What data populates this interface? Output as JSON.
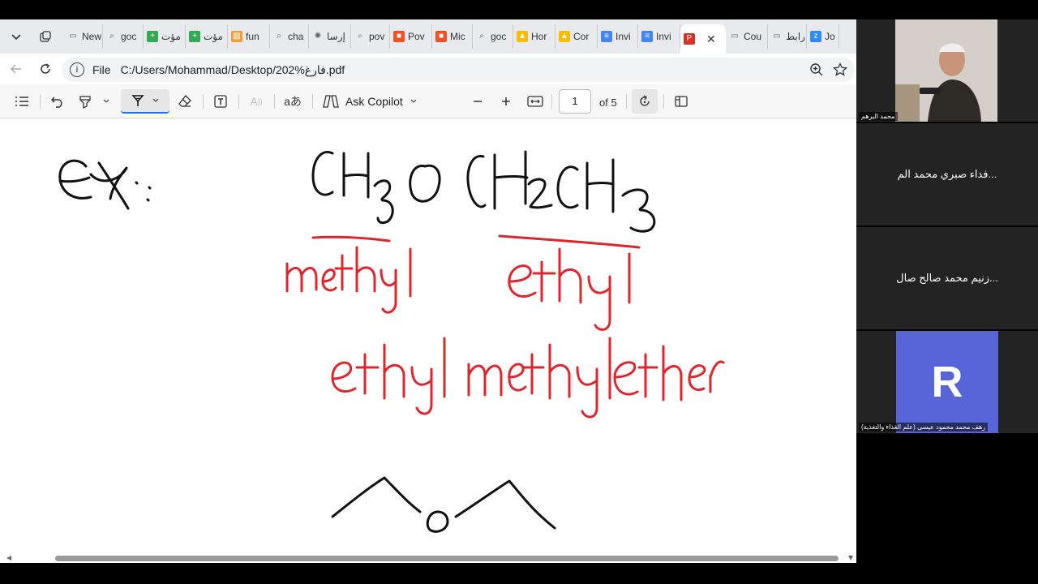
{
  "browser": {
    "tabs": [
      {
        "label": "New",
        "icon": "page-icon",
        "color": "#5f6368"
      },
      {
        "label": "goc",
        "icon": "search-icon",
        "color": "#5f6368"
      },
      {
        "label": "مؤت",
        "icon": "plus-doc-icon",
        "color": "#34a853"
      },
      {
        "label": "مؤت",
        "icon": "plus-doc-icon",
        "color": "#34a853"
      },
      {
        "label": "fun",
        "icon": "image-icon",
        "color": "#e9a23b"
      },
      {
        "label": "cha",
        "icon": "search-icon",
        "color": "#5f6368"
      },
      {
        "label": "إرسا",
        "icon": "openai-icon",
        "color": "#5f6368"
      },
      {
        "label": "pov",
        "icon": "search-icon",
        "color": "#5f6368"
      },
      {
        "label": "Pov",
        "icon": "microsoft-icon",
        "color": "#f25022"
      },
      {
        "label": "Mic",
        "icon": "microsoft-icon",
        "color": "#f25022"
      },
      {
        "label": "goc",
        "icon": "search-icon",
        "color": "#5f6368"
      },
      {
        "label": "Hor",
        "icon": "drive-icon",
        "color": "#fbbc04"
      },
      {
        "label": "Cor",
        "icon": "drive-icon",
        "color": "#fbbc04"
      },
      {
        "label": "Invi",
        "icon": "docs-icon",
        "color": "#4285f4"
      },
      {
        "label": "Invi",
        "icon": "docs-icon",
        "color": "#4285f4"
      },
      {
        "label": "",
        "icon": "pdf-icon",
        "color": "#d93025",
        "active": true
      },
      {
        "label": "Cou",
        "icon": "page-icon",
        "color": "#5f6368"
      },
      {
        "label": "رابط",
        "icon": "page-icon",
        "color": "#5f6368"
      },
      {
        "label": "Jo",
        "icon": "zoom-icon",
        "color": "#2d8cff"
      }
    ],
    "address": {
      "prefix": "File",
      "url": "C:/Users/Mohammad/Desktop/202%فارغ.pdf"
    }
  },
  "pdf_toolbar": {
    "ask_copilot": "Ask Copilot",
    "page_current": "1",
    "page_total": "of 5"
  },
  "annotations": {
    "ink_black": "#111111",
    "ink_red": "#e0262d"
  },
  "participants": [
    {
      "type": "video",
      "caption": "محمد البرهم"
    },
    {
      "type": "name",
      "name": "...فداء صبري محمد الم"
    },
    {
      "type": "name",
      "name": "...زنيم محمد صالح صال"
    },
    {
      "type": "avatar",
      "initial": "R",
      "avatar_color": "#5865d8",
      "caption": "رهف محمد محمود عيسى (علم الغذاء والتغذية)"
    }
  ]
}
